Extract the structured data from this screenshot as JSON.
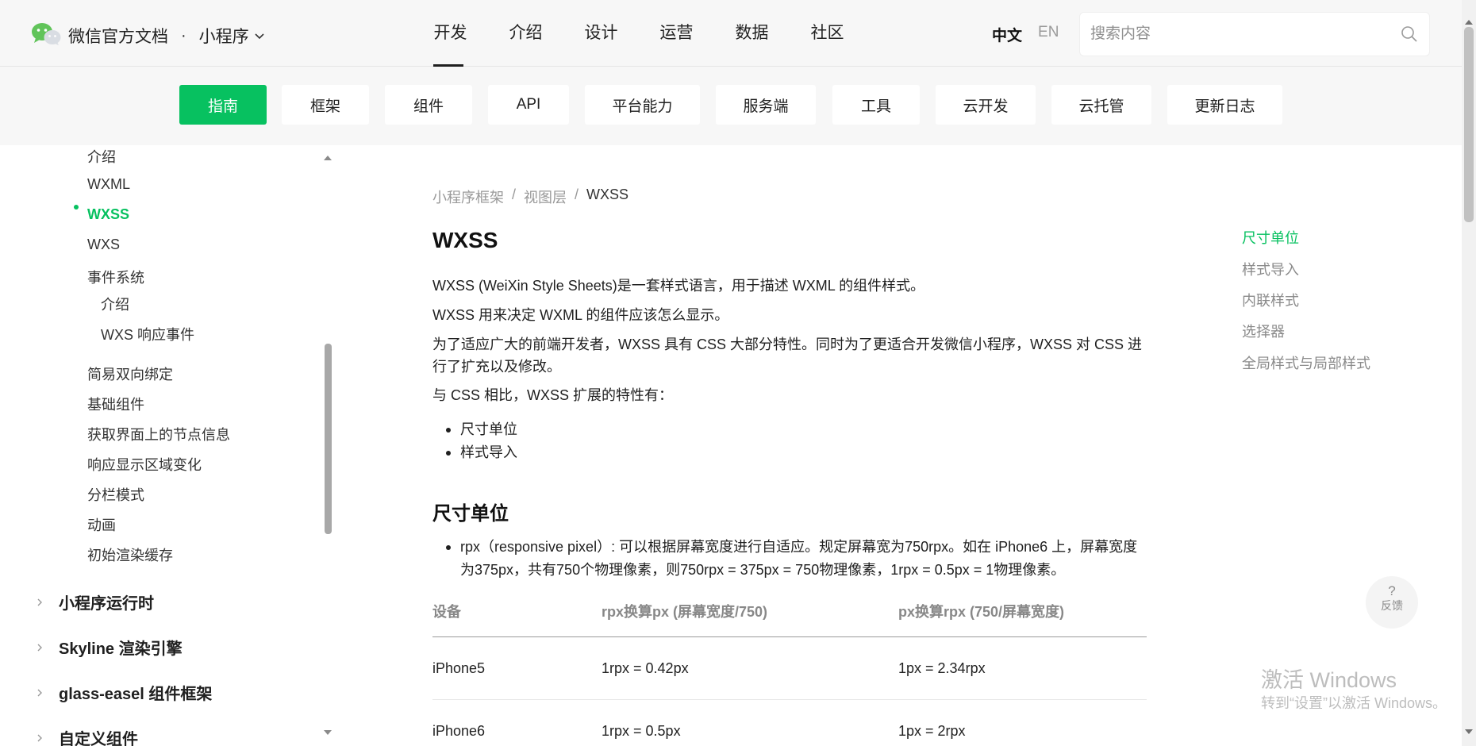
{
  "header": {
    "brand": "微信官方文档",
    "separator": "·",
    "product": "小程序",
    "nav": [
      "开发",
      "介绍",
      "设计",
      "运营",
      "数据",
      "社区"
    ],
    "lang_zh": "中文",
    "lang_en": "EN",
    "search_placeholder": "搜索内容"
  },
  "subnav": [
    "指南",
    "框架",
    "组件",
    "API",
    "平台能力",
    "服务端",
    "工具",
    "云开发",
    "云托管",
    "更新日志"
  ],
  "sidebar": {
    "items": [
      "介绍",
      "WXML",
      "WXSS",
      "WXS",
      "事件系统",
      "介绍",
      "WXS 响应事件",
      "简易双向绑定",
      "基础组件",
      "获取界面上的节点信息",
      "响应显示区域变化",
      "分栏模式",
      "动画",
      "初始渲染缓存"
    ],
    "sections": [
      "小程序运行时",
      "Skyline 渲染引擎",
      "glass-easel 组件框架",
      "自定义组件"
    ]
  },
  "content": {
    "breadcrumb": [
      "小程序框架",
      "视图层",
      "WXSS"
    ],
    "breadcrumb_sep": "/",
    "title": "WXSS",
    "p1": "WXSS (WeiXin Style Sheets)是一套样式语言，用于描述 WXML 的组件样式。",
    "p2": "WXSS 用来决定 WXML 的组件应该怎么显示。",
    "p3": "为了适应广大的前端开发者，WXSS 具有 CSS 大部分特性。同时为了更适合开发微信小程序，WXSS 对 CSS 进行了扩充以及修改。",
    "p4": "与 CSS 相比，WXSS 扩展的特性有：",
    "features": [
      "尺寸单位",
      "样式导入"
    ],
    "section_title": "尺寸单位",
    "rpx_text": "rpx（responsive pixel）: 可以根据屏幕宽度进行自适应。规定屏幕宽为750rpx。如在 iPhone6 上，屏幕宽度为375px，共有750个物理像素，则750rpx = 375px = 750物理像素，1rpx = 0.5px = 1物理像素。",
    "table": {
      "headers": [
        "设备",
        "rpx换算px (屏幕宽度/750)",
        "px换算rpx (750/屏幕宽度)"
      ],
      "rows": [
        [
          "iPhone5",
          "1rpx = 0.42px",
          "1px = 2.34rpx"
        ],
        [
          "iPhone6",
          "1rpx = 0.5px",
          "1px = 2rpx"
        ]
      ]
    }
  },
  "toc": [
    "尺寸单位",
    "样式导入",
    "内联样式",
    "选择器",
    "全局样式与局部样式"
  ],
  "feedback": {
    "icon": "?",
    "label": "反馈"
  },
  "watermark": {
    "line1": "激活 Windows",
    "line2": "转到“设置”以激活 Windows。"
  },
  "colors": {
    "accent": "#07c160",
    "header_bg": "#f7f7f7",
    "text": "#1f1f1f",
    "muted": "#8a8a8a"
  }
}
